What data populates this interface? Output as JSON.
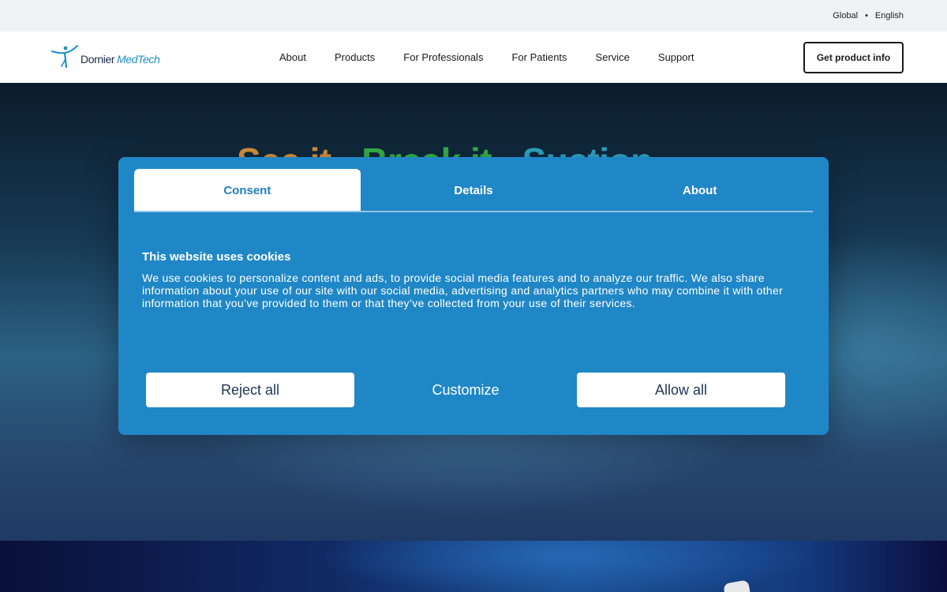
{
  "topbar": {
    "region": "Global",
    "separator": "•",
    "language": "English"
  },
  "header": {
    "logo": {
      "part1": "Dornier",
      "part2": "MedTech"
    },
    "nav": [
      "About",
      "Products",
      "For Professionals",
      "For Patients",
      "Service",
      "Support"
    ],
    "cta_label": "Get product info"
  },
  "hero": {
    "headline": [
      "See it.",
      "Break it.",
      "Suction."
    ]
  },
  "consent": {
    "tabs": [
      {
        "label": "Consent",
        "active": true
      },
      {
        "label": "Details",
        "active": false
      },
      {
        "label": "About",
        "active": false
      }
    ],
    "title": "This website uses cookies",
    "body": "We use cookies to personalize content and ads, to provide social media features and to analyze our traffic. We also share information about your use of our site with our social media, advertising and analytics partners who may combine it with other information that you’ve provided to them or that they’ve collected from your use of their services.",
    "buttons": {
      "reject": "Reject all",
      "customize": "Customize",
      "allow": "Allow all"
    }
  },
  "colors": {
    "dialog_bg": "#2087c7",
    "tab_active_text": "#1e7fc0",
    "brand_blue": "#1e8fc7",
    "brand_navy": "#1a2a4d"
  }
}
